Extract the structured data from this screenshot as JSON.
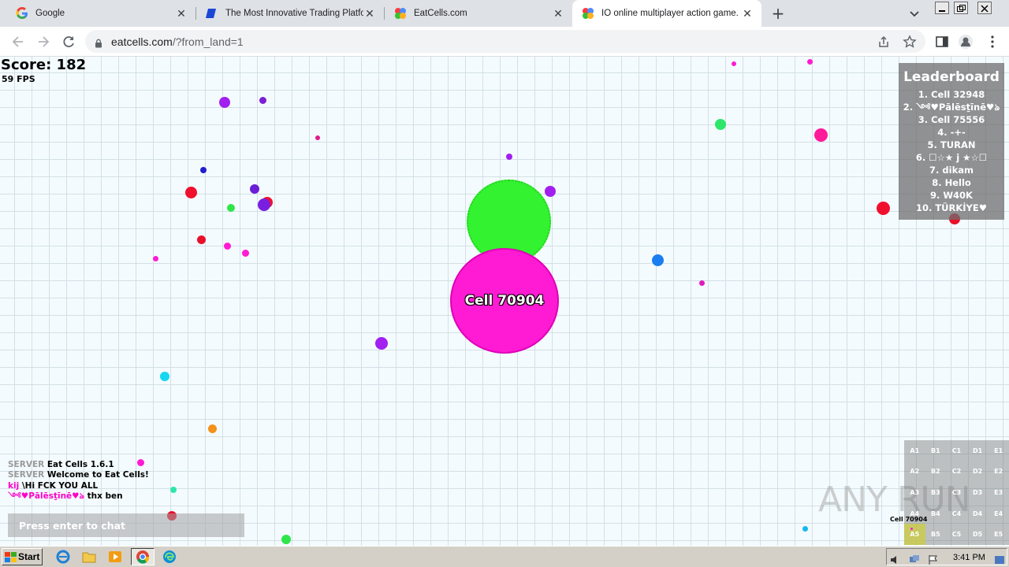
{
  "browser": {
    "tabs": [
      {
        "title": "Google",
        "favicon": "google-g-icon",
        "active": false
      },
      {
        "title": "The Most Innovative Trading Platform",
        "favicon": "trading-platform-icon",
        "active": false
      },
      {
        "title": "EatCells.com",
        "favicon": "eatcells-icon",
        "active": false
      },
      {
        "title": "IO online multiplayer action game. Sm",
        "favicon": "eatcells-icon",
        "active": true
      }
    ],
    "url_host": "eatcells.com",
    "url_path": "/?from_land=1"
  },
  "game": {
    "score_text": "Score: 182",
    "fps_text": "59 FPS",
    "player_cell_name": "Cell 70904",
    "colors": {
      "player": "#ff1ad3",
      "green_cell": "#33f22f",
      "grid": "#d3e0e6"
    },
    "leaderboard": {
      "title": "Leaderboard",
      "entries": [
        "1. Cell 32948",
        "2. ༺♥Pālēsṯīnē♥ঌ",
        "3. Cell 75556",
        "4. -+-",
        "5. TURAN",
        "6. ☐☆★ j ★☆☐",
        "7. dikam",
        "8. Hello",
        "9. W40K",
        "10. TÜRKİYE♥"
      ]
    },
    "chat": {
      "messages": [
        {
          "name": "SERVER",
          "text": "Eat Cells 1.6.1"
        },
        {
          "name": "SERVER",
          "text": "Welcome to Eat Cells!"
        },
        {
          "name": "kij",
          "text": "\\Hi FCK YOU ALL"
        },
        {
          "name": "༺♥Pālēsṯīnē♥ঌ",
          "text": "thx ben"
        }
      ],
      "input_placeholder": "Press enter to chat"
    },
    "minimap": {
      "rows": [
        [
          "A1",
          "B1",
          "C1",
          "D1",
          "E1"
        ],
        [
          "A2",
          "B2",
          "C2",
          "D2",
          "E2"
        ],
        [
          "A3",
          "B3",
          "C3",
          "D3",
          "E3"
        ],
        [
          "A4",
          "B4",
          "C4",
          "D4",
          "E4"
        ],
        [
          "A5",
          "B5",
          "C5",
          "D5",
          "E5"
        ]
      ],
      "active_sector": "A5",
      "player_label": "Cell 70904"
    }
  },
  "watermark": "ANY RUN",
  "taskbar": {
    "start_label": "Start",
    "clock": "3:41 PM"
  }
}
